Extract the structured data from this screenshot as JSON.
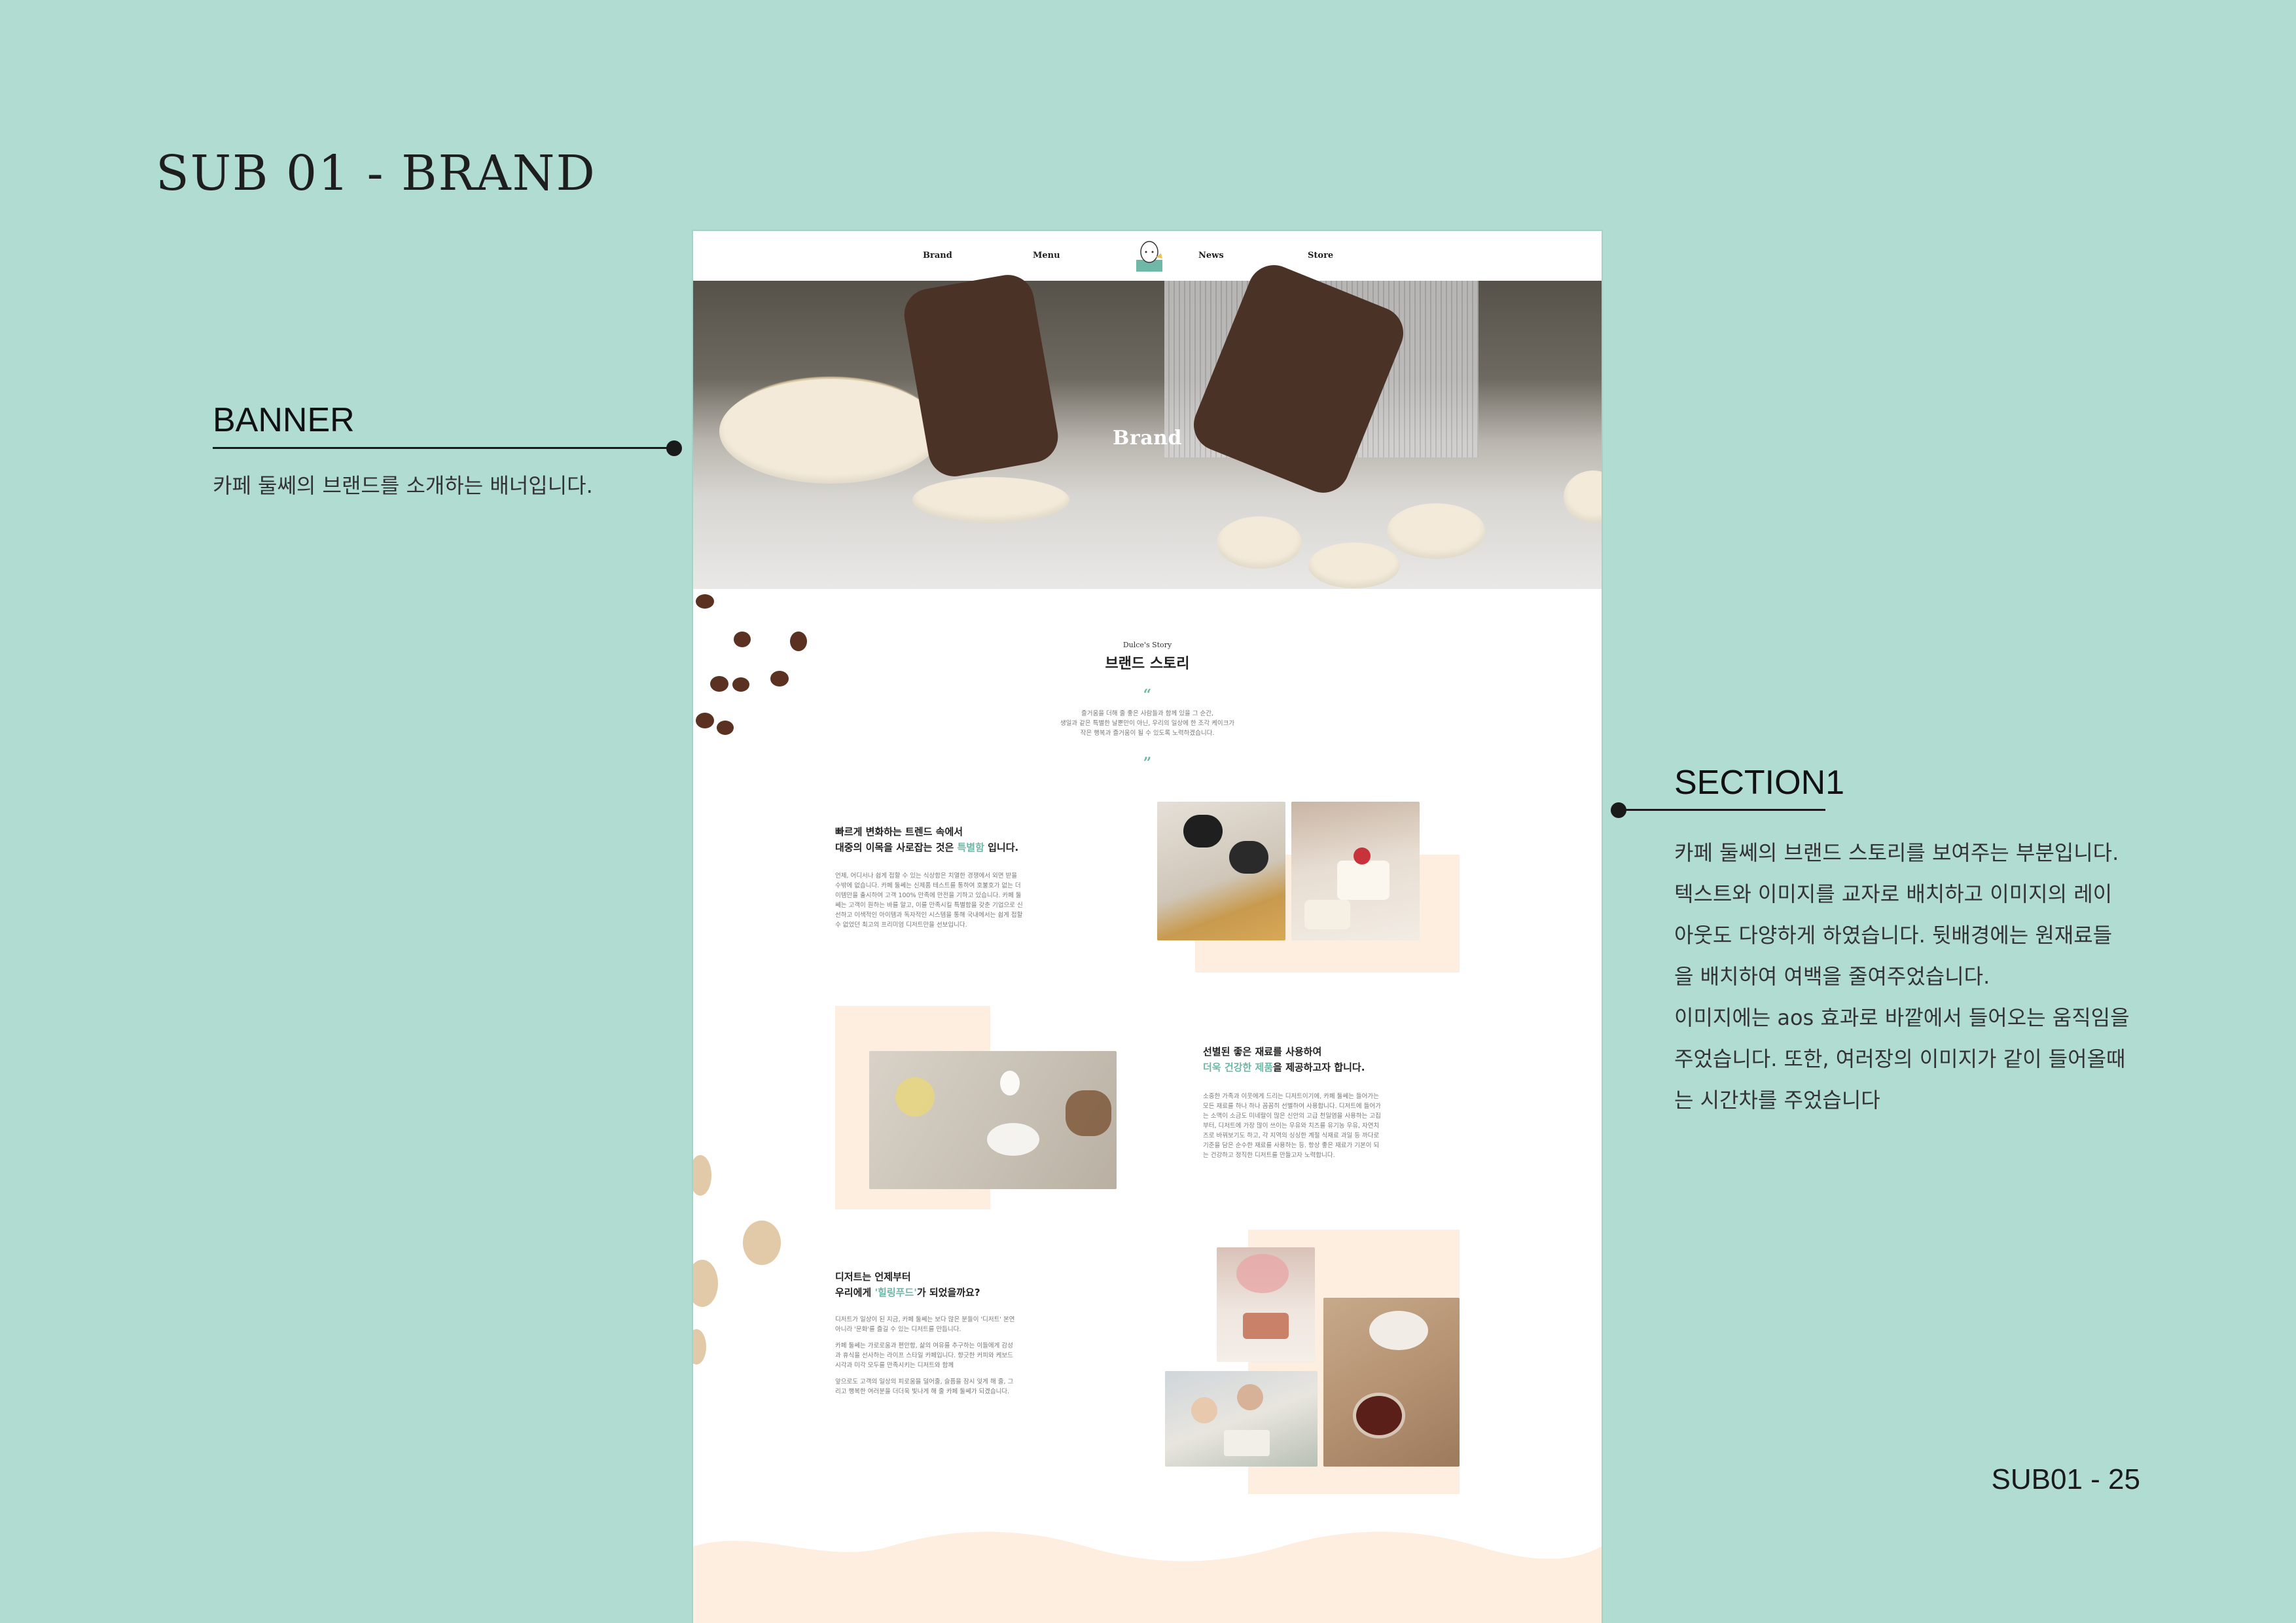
{
  "board": {
    "title": "SUB 01 - BRAND",
    "page_number": "SUB01 - 25"
  },
  "annotations": {
    "banner": {
      "title": "BANNER",
      "description": "카페 둘쎄의 브랜드를 소개하는 배너입니다."
    },
    "section1": {
      "title": "SECTION1",
      "lines": [
        "카페 둘쎄의 브랜드 스토리를 보여주는 부분입니다.",
        "텍스트와 이미지를 교자로 배치하고 이미지의 레이",
        "아웃도 다양하게 하였습니다. 뒷배경에는 원재료들",
        "을 배치하여 여백을 줄여주었습니다.",
        "이미지에는 aos 효과로 바깥에서 들어오는 움직임을",
        "주었습니다. 또한, 여러장의 이미지가 같이 들어올때",
        "는 시간차를 주었습니다"
      ]
    }
  },
  "site": {
    "nav": {
      "brand": "Brand",
      "menu": "Menu",
      "news": "News",
      "store": "Store"
    },
    "banner_title": "Brand",
    "story": {
      "subtitle": "Dulce's Story",
      "title": "브랜드 스토리",
      "open_quote": "“",
      "close_quote": "”",
      "paragraph": [
        "즐거움을 더해 줄 좋은 사람들과 함께 있을 그 순간,",
        "생일과 같은 특별한 날뿐만이 아닌, 우리의 일상에 한 조각 케이크가",
        "작은 행복과 즐거움이 될 수 있도록 노력하겠습니다."
      ]
    },
    "block1": {
      "title_line1": "빠르게 변화하는 트렌드 속에서",
      "title_line2_pre": "대중의 이목을 사로잡는 것은 ",
      "title_line2_accent": "특별함",
      "title_line2_post": " 입니다.",
      "body": [
        "언제, 어디서나 쉽게 접할 수 있는 식상함은 치열한 경쟁에서 외면 받을",
        "수밖에 없습니다. 카페 둘쎄는 신제품 테스트를 통하여 호불호가 없는 더",
        "이템만을 출시하여 고객 100% 만족에 만전을 기하고 있습니다. 카페 둘",
        "쎄는 고객이 원하는 바를 알고, 이를 만족시킬 특별함을 갖춘 기업으로 신",
        "선하고 이색적인 아이템과 독자적인 시스템을 통해 국내에서는 쉽게 접할",
        "수 없었던 최고의 프리미엄 디저트만을 선보입니다."
      ]
    },
    "block2": {
      "title_line1": "선별된 좋은 재료를 사용하여",
      "title_line2_accent": "더욱 건강한 제품",
      "title_line2_post": "을 제공하고자 합니다.",
      "body": [
        "소중한 가족과 이웃에게 드리는 디저트이기에, 카페 둘쎄는 들어가는",
        "모든 재료를 하나 하나 꼼꼼히 선별하여 사용합니다. 디저트에 들어가",
        "는 소맥이 소금도 미네랄이 많은 신안의 고급 천일염을 사용하는 고집",
        "부터, 디저트에 가장 많이 쓰이는 우유와 치즈를 유기농 우유, 자연치",
        "즈로 바꿔보기도 하고, 각 지역의 싱싱한 계절 식재료 과일 등 까다로",
        "기준을 담은 순수한 재료를 사용하는 등. 항상 좋은 재료가 기본이 되",
        "는 건강하고 정직한 디저트를 만들고자 노력합니다."
      ]
    },
    "block3": {
      "title_line1": "디저트는 언제부터",
      "title_line2_pre": "우리에게 ",
      "title_line2_accent": "'힐링푸드'",
      "title_line2_post": "가 되었을까요?",
      "body": [
        "디저트가 일상이 된 지금, 카페 둘쎄는 보다 많은 분들이 '디저트' 본연",
        "아니라 '문화'를 즐길 수 있는 디저트를 만듭니다.",
        "",
        "카페 둘쎄는 가로로움과 편안함, 삶의 여유를 추구하는 이들에게 감성",
        "과 휴식을 선사하는 라이프 스타일 카페입니다. 향긋한 커피와 케보드",
        "시각과 미각 모두를 만족시키는 디저트와 함께",
        "",
        "앞으로도 고객의 일상의 피로움을 덜어줄, 슬픔을 잠시 잊게 해 줄, 그",
        "리고 행복한 여러분을 더더욱 빛나게 해 줄 카페 둘쎄가 되겠습니다."
      ]
    }
  },
  "colors": {
    "board_bg": "#b0dcd2",
    "accent": "#6fb7a6",
    "peach": "#fdeee0"
  }
}
